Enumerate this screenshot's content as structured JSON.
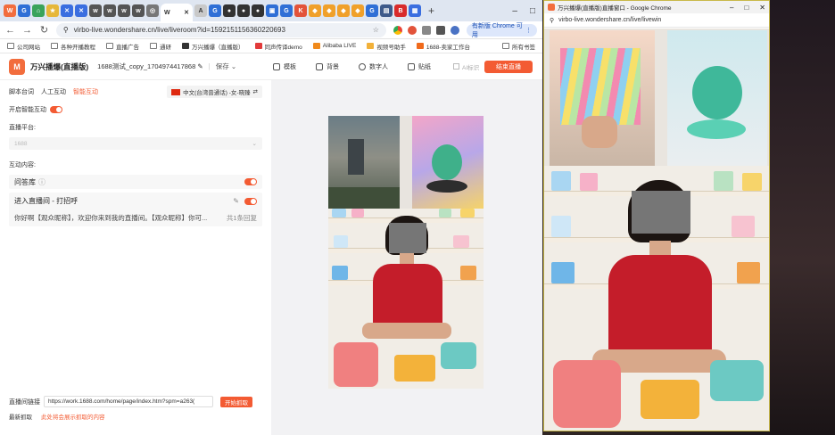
{
  "main_window": {
    "active_tab_label": "W",
    "address": "virbo-live.wondershare.cn/live/liveroom?id=1592151156360220693",
    "update_button": "有新版 Chrome 可用",
    "bookmarks": [
      "公司网站",
      "各种开播教程",
      "直播广告",
      "通研",
      "万兴播爆（直播版）",
      "同声传译demo",
      "Alibaba LIVE",
      "视频号助手",
      "1688-卖家工作台"
    ],
    "bookmarks_right": "所有书签"
  },
  "app": {
    "logo_text": "M",
    "title": "万兴播爆(直播版)",
    "room_name": "1688测试_copy_1704974417868",
    "save": "保存",
    "tools": [
      "模板",
      "背景",
      "数字人",
      "贴纸"
    ],
    "ai_label": "AI标识",
    "end_button": "结束直播"
  },
  "left_panel": {
    "subtabs": [
      "脚本台词",
      "人工互动",
      "智能互动"
    ],
    "active_subtab": "智能互动",
    "language": "中文(台湾普通话) -女-晓臻",
    "smart_interaction_label": "开启智能互动",
    "platform_label": "直播平台:",
    "platform_value": "1688",
    "interaction_label": "互动内容:",
    "qa_label": "问答库",
    "welcome_title": "进入直播间 - 打招呼",
    "welcome_text": "你好啊【观众昵称】，欢迎你来到我的直播间。【观众昵称】你可...",
    "welcome_count": "共1条回复",
    "live_link_label": "直播间链接",
    "live_link_value": "https://work.1688.com/home/page/index.htm?spm=a263(",
    "fetch_button": "开始抓取",
    "last_fetch_label": "最新抓取",
    "last_fetch_note": "此处将会展示抓取的内容"
  },
  "popup_window": {
    "title": "万兴播爆(直播版)直播窗口 - Google Chrome",
    "address": "virbo-live.wondershare.cn/live/livewin"
  },
  "colors": {
    "accent": "#f35b33",
    "shirt": "#c41d2a"
  }
}
